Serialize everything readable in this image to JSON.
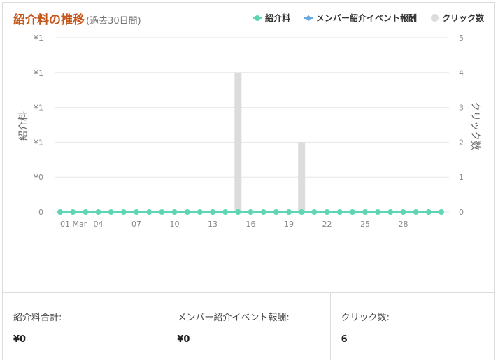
{
  "header": {
    "title": "紹介料の推移",
    "subtitle": "(過去30日間)"
  },
  "legend": [
    {
      "label": "紹介料",
      "color": "#5ed6b4",
      "shape": "dot-line"
    },
    {
      "label": "メンバー紹介イベント報酬",
      "color": "#6aa9e0",
      "shape": "diamond-line"
    },
    {
      "label": "クリック数",
      "color": "#dcdcdc",
      "shape": "circle"
    }
  ],
  "chart_data": {
    "type": "bar+line",
    "title": "紹介料の推移",
    "subtitle": "(過去30日間)",
    "ylabel_left": "紹介料",
    "ylabel_right": "クリック数",
    "y_left_ticks": [
      "0",
      "¥0",
      "¥1",
      "¥1",
      "¥1",
      "¥1"
    ],
    "y_right_ticks": [
      "0",
      "1",
      "2",
      "3",
      "4",
      "5"
    ],
    "y_right_lim": [
      0,
      5
    ],
    "x_tick_labels": [
      {
        "day": 1,
        "label": "01 Mar"
      },
      {
        "day": 4,
        "label": "04"
      },
      {
        "day": 7,
        "label": "07"
      },
      {
        "day": 10,
        "label": "10"
      },
      {
        "day": 13,
        "label": "13"
      },
      {
        "day": 16,
        "label": "16"
      },
      {
        "day": 19,
        "label": "19"
      },
      {
        "day": 22,
        "label": "22"
      },
      {
        "day": 25,
        "label": "25"
      },
      {
        "day": 28,
        "label": "28"
      }
    ],
    "days": [
      1,
      2,
      3,
      4,
      5,
      6,
      7,
      8,
      9,
      10,
      11,
      12,
      13,
      14,
      15,
      16,
      17,
      18,
      19,
      20,
      21,
      22,
      23,
      24,
      25,
      26,
      27,
      28,
      29,
      30,
      31
    ],
    "series": [
      {
        "name": "紹介料",
        "type": "line",
        "axis": "left",
        "color": "#5ed6b4",
        "values": [
          0,
          0,
          0,
          0,
          0,
          0,
          0,
          0,
          0,
          0,
          0,
          0,
          0,
          0,
          0,
          0,
          0,
          0,
          0,
          0,
          0,
          0,
          0,
          0,
          0,
          0,
          0,
          0,
          0,
          0,
          0
        ]
      },
      {
        "name": "メンバー紹介イベント報酬",
        "type": "line",
        "axis": "left",
        "color": "#6aa9e0",
        "values": [
          0,
          0,
          0,
          0,
          0,
          0,
          0,
          0,
          0,
          0,
          0,
          0,
          0,
          0,
          0,
          0,
          0,
          0,
          0,
          0,
          0,
          0,
          0,
          0,
          0,
          0,
          0,
          0,
          0,
          0,
          0
        ]
      },
      {
        "name": "クリック数",
        "type": "bar",
        "axis": "right",
        "color": "#dcdcdc",
        "values": [
          0,
          0,
          0,
          0,
          0,
          0,
          0,
          0,
          0,
          0,
          0,
          0,
          0,
          0,
          4,
          0,
          0,
          0,
          0,
          2,
          0,
          0,
          0,
          0,
          0,
          0,
          0,
          0,
          0,
          0,
          0
        ]
      }
    ],
    "grid": true,
    "legend_position": "top-right"
  },
  "footer": {
    "stats": [
      {
        "label": "紹介料合計:",
        "value": "¥0"
      },
      {
        "label": "メンバー紹介イベント報酬:",
        "value": "¥0"
      },
      {
        "label": "クリック数:",
        "value": "6"
      }
    ]
  }
}
